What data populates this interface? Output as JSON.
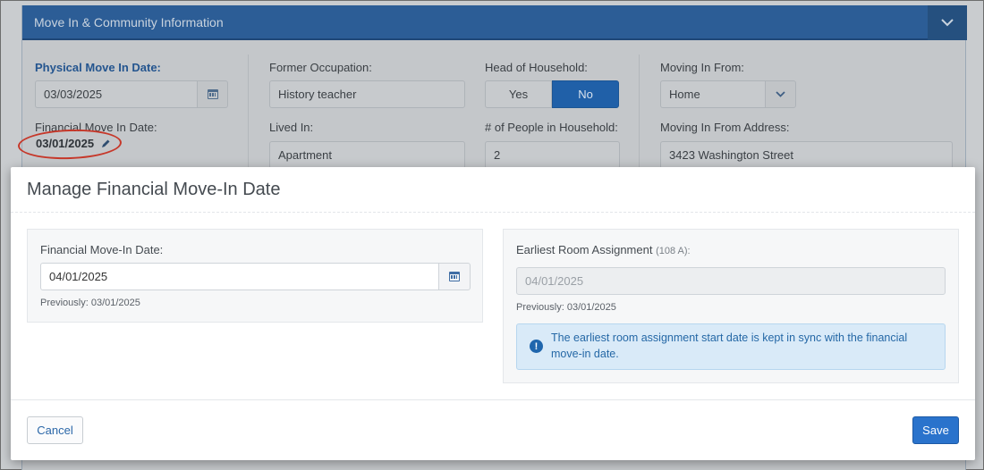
{
  "background": {
    "panel_title": "Move In & Community Information",
    "physical_move_in_label": "Physical Move In Date:",
    "physical_move_in_value": "03/03/2025",
    "financial_move_in_label": "Financial Move In Date:",
    "financial_move_in_value": "03/01/2025",
    "former_occupation_label": "Former Occupation:",
    "former_occupation_value": "History teacher",
    "lived_in_label": "Lived In:",
    "lived_in_value": "Apartment",
    "head_of_household_label": "Head of Household:",
    "yes_label": "Yes",
    "no_label": "No",
    "people_label": "# of People in Household:",
    "people_value": "2",
    "moving_in_from_label": "Moving In From:",
    "moving_in_from_value": "Home",
    "moving_in_address_label": "Moving In From Address:",
    "moving_in_address_value": "3423 Washington Street"
  },
  "modal": {
    "title": "Manage Financial Move-In Date",
    "left": {
      "label": "Financial Move-In Date:",
      "value": "04/01/2025",
      "hint": "Previously: 03/01/2025"
    },
    "right": {
      "label": "Earliest Room Assignment",
      "label_sub": "(108 A):",
      "value": "04/01/2025",
      "hint": "Previously: 03/01/2025",
      "info_text": "The earliest room assignment start date is kept in sync with the financial move-in date."
    },
    "cancel_label": "Cancel",
    "save_label": "Save"
  },
  "colors": {
    "header": "#2c5d96",
    "primary": "#2a73cc",
    "info_bg": "#d9eaf8",
    "highlight_ellipse": "#c6382a"
  }
}
